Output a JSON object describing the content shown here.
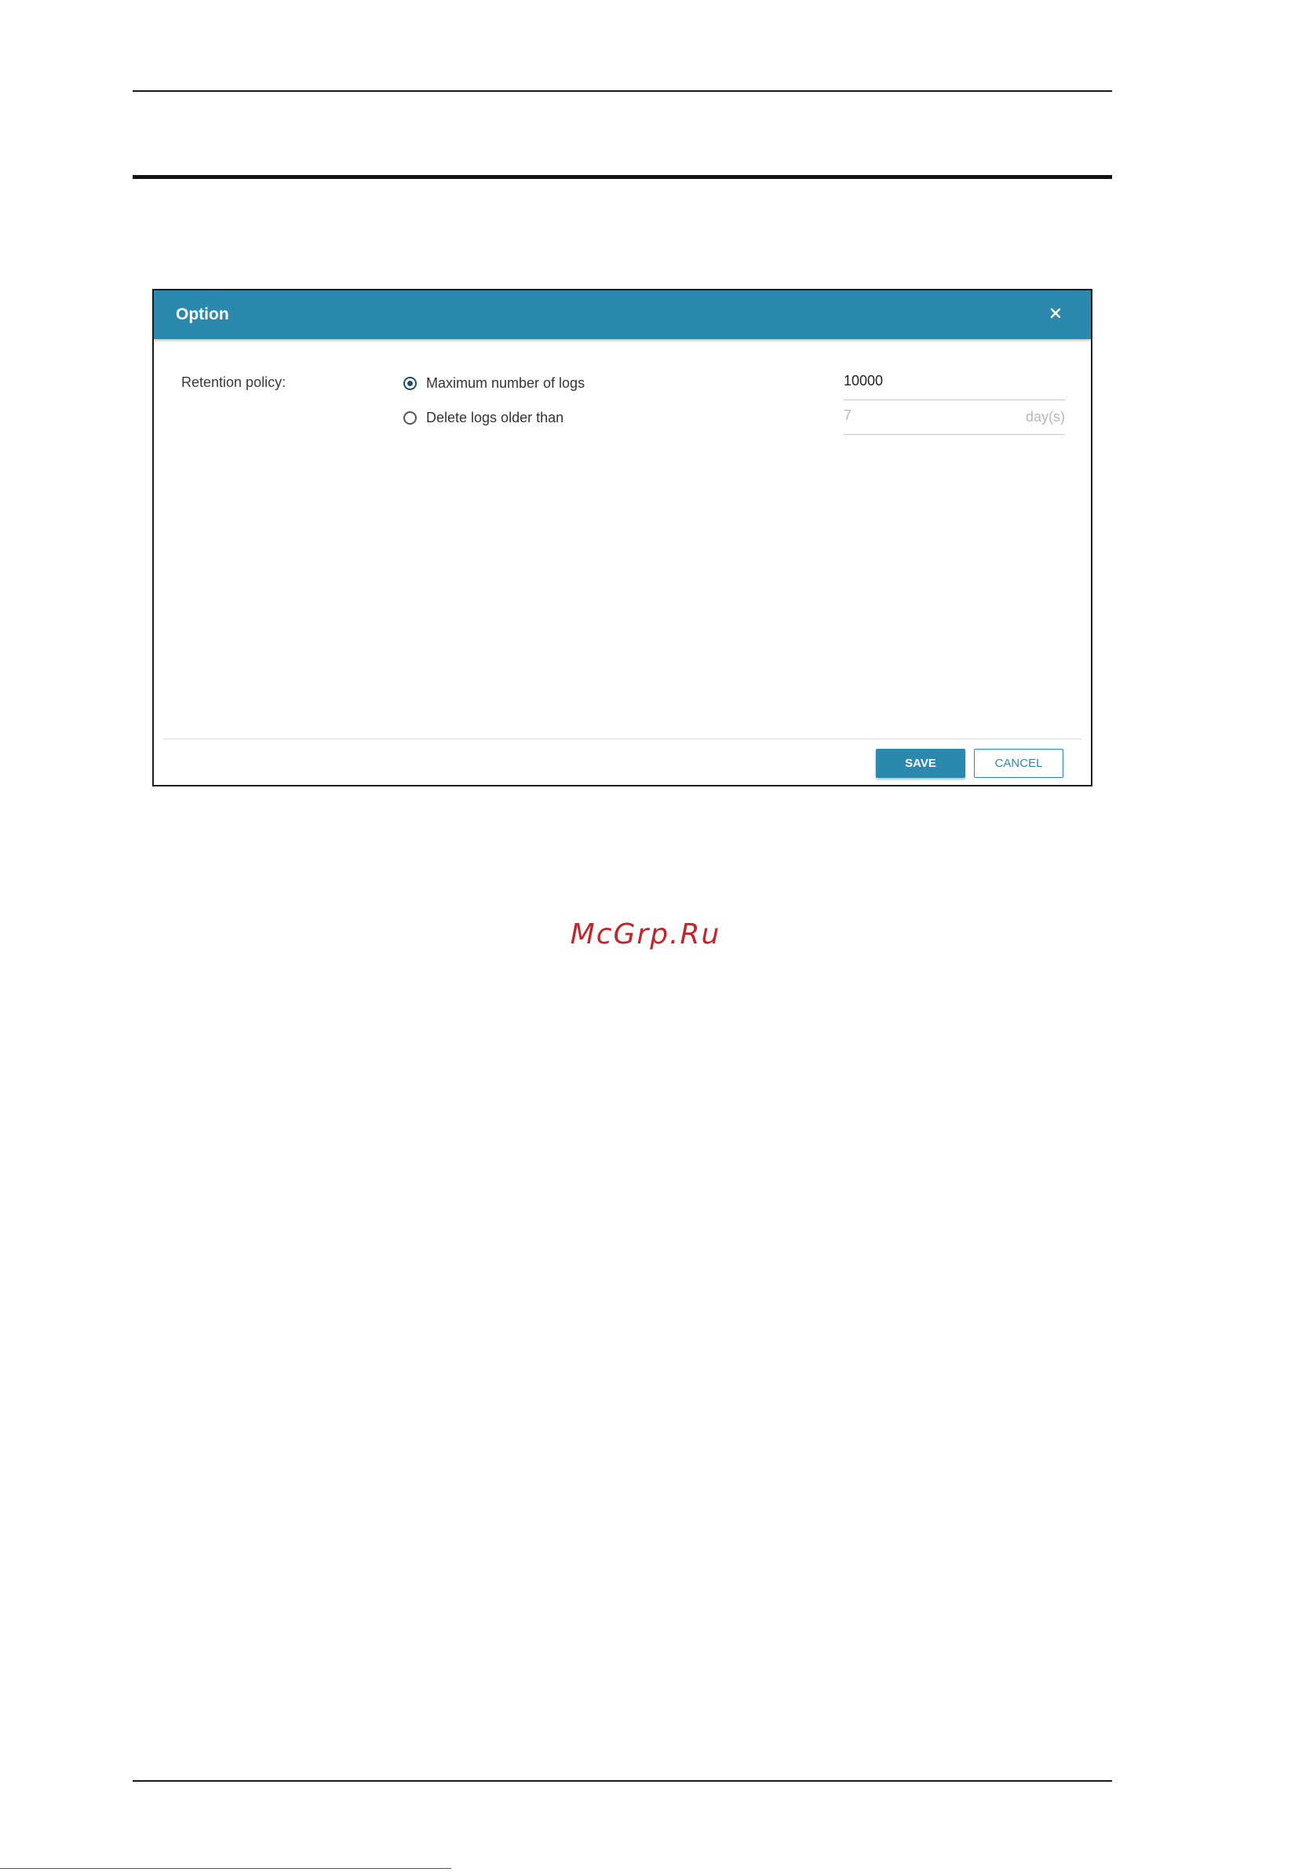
{
  "dialog": {
    "title": "Option",
    "close_icon": "close-icon",
    "retention_label": "Retention policy:",
    "options": [
      {
        "label": "Maximum number of logs",
        "selected": true,
        "value": "10000",
        "unit": ""
      },
      {
        "label": "Delete logs older than",
        "selected": false,
        "value": "7",
        "unit": "day(s)"
      }
    ],
    "save_label": "SAVE",
    "cancel_label": "CANCEL"
  },
  "watermark": "McGrp.Ru",
  "colors": {
    "header": "#2b89ad",
    "radio_selected": "#1e4e6e",
    "watermark": "#c0272d"
  }
}
